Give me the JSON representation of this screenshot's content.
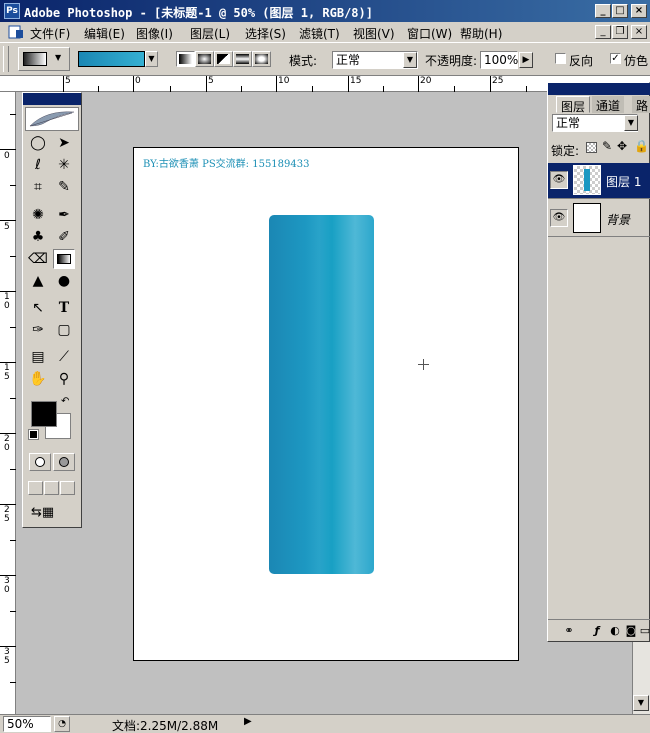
{
  "window": {
    "title": "Adobe Photoshop - [未标题-1 @ 50% (图层 1, RGB/8)]",
    "app_icon": "photoshop-app-icon",
    "buttons": {
      "minimize": "_",
      "maximize": "□",
      "close": "×"
    }
  },
  "menu": {
    "items": [
      "文件(F)",
      "编辑(E)",
      "图像(I)",
      "图层(L)",
      "选择(S)",
      "滤镜(T)",
      "视图(V)",
      "窗口(W)",
      "帮助(H)"
    ],
    "doc_buttons": {
      "minimize": "_",
      "restore": "❐",
      "close": "×"
    }
  },
  "options": {
    "mode_label": "模式:",
    "mode_value": "正常",
    "opacity_label": "不透明度:",
    "opacity_value": "100%",
    "reverse_label": "反向",
    "dither_label": "仿色",
    "gradient_colors": [
      "#1b87b4",
      "#35b0d2"
    ]
  },
  "ruler": {
    "h_labels": [
      "5",
      "0",
      "5",
      "10",
      "15",
      "20",
      "25"
    ],
    "v_labels": [
      "0",
      "5",
      "1 0",
      "1 5",
      "2 0",
      "2 5",
      "3 0",
      "3 5"
    ]
  },
  "tools": {
    "foreground": "#000000",
    "background": "#ffffff"
  },
  "canvas": {
    "watermark": "BY:古欲香萧 PS交流群: 155189433",
    "gradient": {
      "colors": [
        "#1b87b4",
        "#1d98c2",
        "#29a3c9",
        "#18a0c4",
        "#4fb8d6",
        "#2ca7cc"
      ]
    }
  },
  "layers_panel": {
    "tabs": [
      "图层",
      "通道",
      "路"
    ],
    "blend_mode": "正常",
    "lock_label": "锁定:",
    "layers": [
      {
        "name": "图层 1",
        "selected": true
      },
      {
        "name": "背景",
        "selected": false
      }
    ]
  },
  "status": {
    "zoom": "50%",
    "doc_info": "文档:2.25M/2.88M"
  }
}
